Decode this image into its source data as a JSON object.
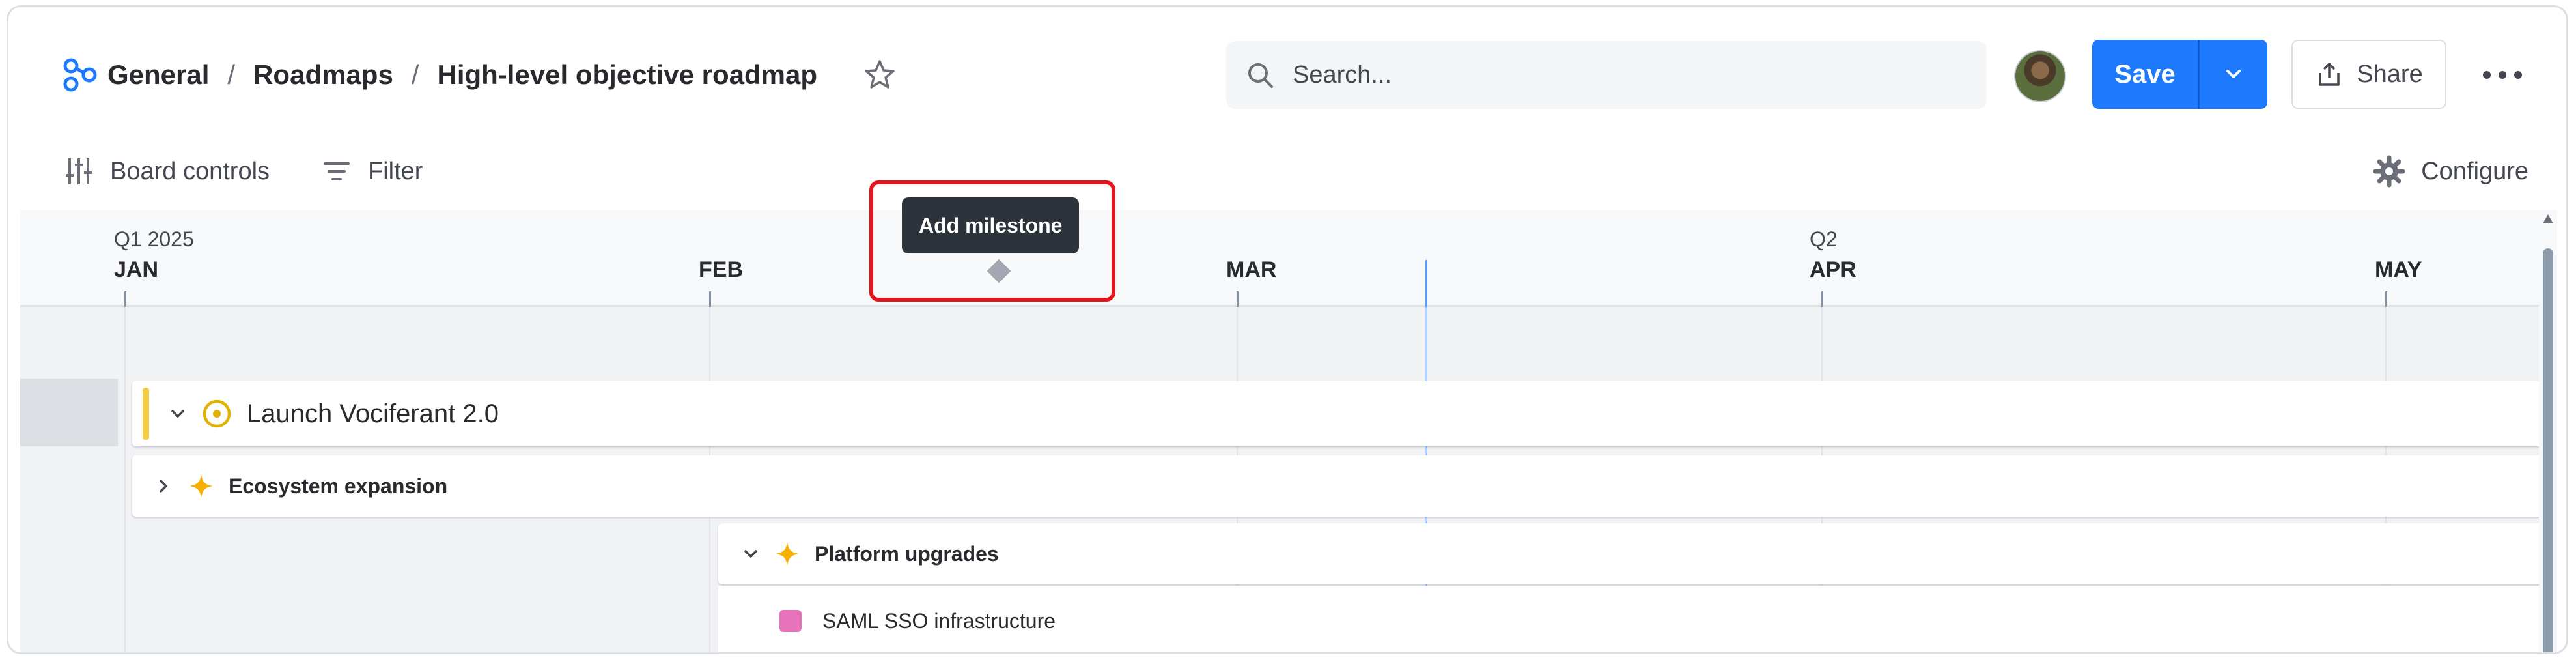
{
  "breadcrumb": {
    "items": [
      "General",
      "Roadmaps",
      "High-level objective roadmap"
    ],
    "separator": "/"
  },
  "search": {
    "placeholder": "Search..."
  },
  "actions": {
    "save_label": "Save",
    "share_label": "Share"
  },
  "toolbar": {
    "board_controls_label": "Board controls",
    "filter_label": "Filter",
    "configure_label": "Configure"
  },
  "timeline": {
    "quarters": [
      "Q1 2025",
      "Q2"
    ],
    "months": [
      "JAN",
      "FEB",
      "MAR",
      "APR",
      "MAY"
    ],
    "tooltip": "Add milestone"
  },
  "rows": [
    {
      "title": "Launch Vociferant 2.0",
      "icon": "target-icon",
      "expanded": true
    },
    {
      "title": "Ecosystem expansion",
      "icon": "sparkle-icon",
      "expanded": false
    },
    {
      "title": "Platform upgrades",
      "icon": "sparkle-icon",
      "expanded": true
    },
    {
      "title": "SAML SSO infrastructure",
      "icon": "square-icon"
    }
  ],
  "colors": {
    "accent_blue": "#1d7afc",
    "objective_yellow": "#f5cd47",
    "item_pink": "#e774bb",
    "highlight_red": "#e2161c"
  }
}
